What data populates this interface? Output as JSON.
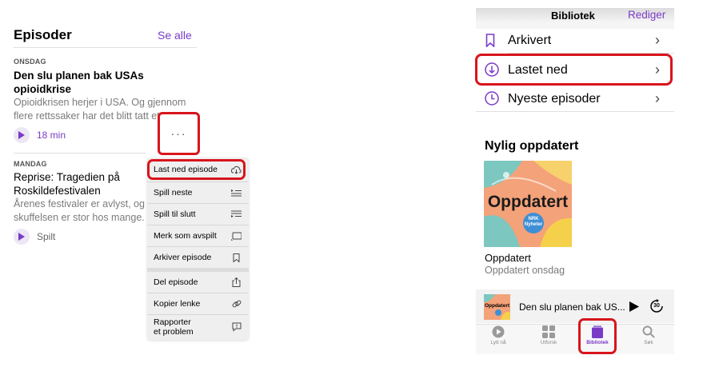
{
  "left": {
    "section_title": "Episoder",
    "see_all": "Se alle",
    "episodes": [
      {
        "day": "ONSDAG",
        "title_line1": "Den slu planen bak USAs",
        "title_line2": "opioidkrise",
        "desc_line1": "Opioidkrisen herjer i USA. Og gjennom",
        "desc_line2": "flere rettssaker har det blitt tatt et op...",
        "meta": "18 min",
        "more": "···"
      },
      {
        "day": "MANDAG",
        "title_line1": "Reprise: Tragedien på",
        "title_line2": "Roskildefestivalen",
        "desc_line1": "Årenes festivaler er avlyst, og",
        "desc_line2": "skuffelsen er stor hos mange.",
        "meta": "Spilt"
      }
    ],
    "menu": [
      {
        "label": "Last ned episode",
        "icon": "cloud-download-icon"
      },
      {
        "label": "Spill neste",
        "icon": "play-next-icon"
      },
      {
        "label": "Spill til slutt",
        "icon": "play-last-icon"
      },
      {
        "label": "Merk som avspilt",
        "icon": "mark-played-icon"
      },
      {
        "label": "Arkiver episode",
        "icon": "bookmark-icon"
      },
      {
        "label": "Del episode",
        "icon": "share-icon"
      },
      {
        "label": "Kopier lenke",
        "icon": "link-icon"
      },
      {
        "label": "Rapporter\net problem",
        "icon": "report-icon"
      }
    ]
  },
  "right": {
    "title": "Bibliotek",
    "edit": "Rediger",
    "rows": [
      {
        "label": "Arkivert",
        "icon": "bookmark-icon"
      },
      {
        "label": "Lastet ned",
        "icon": "download-circle-icon"
      },
      {
        "label": "Nyeste episoder",
        "icon": "clock-icon"
      }
    ],
    "recent_title": "Nylig oppdatert",
    "podcast": {
      "art_word": "Oppdatert",
      "badge_top": "NRK",
      "badge_bottom": "Nyheter",
      "name": "Oppdatert",
      "subtitle": "Oppdatert onsdag"
    },
    "mini_player": {
      "art_word": "Oppdatert",
      "title": "Den slu planen bak US...",
      "skip": "30"
    },
    "tabs": [
      {
        "label": "Lytt nå",
        "icon": "play-circle-icon"
      },
      {
        "label": "Utforsk",
        "icon": "grid-icon"
      },
      {
        "label": "Bibliotek",
        "icon": "library-icon"
      },
      {
        "label": "Søk",
        "icon": "search-icon"
      }
    ]
  },
  "colors": {
    "accent": "#7a3bc7",
    "highlight": "#d9141c",
    "artwork": "#f4a27a"
  }
}
